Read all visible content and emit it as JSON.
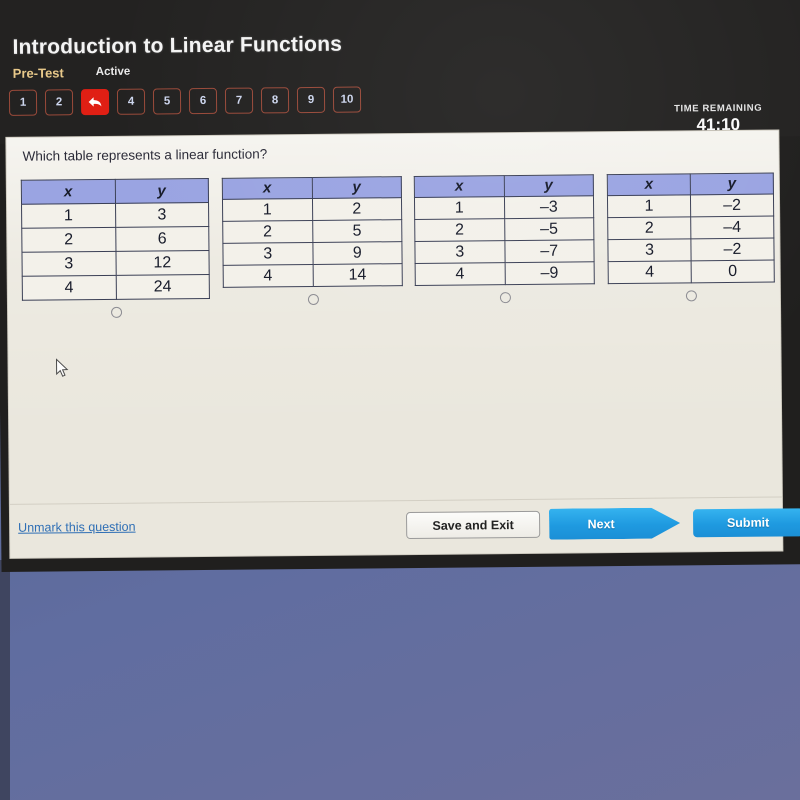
{
  "header": {
    "course_title": "Introduction to Linear Functions",
    "test_type": "Pre-Test",
    "status": "Active",
    "time_label": "TIME REMAINING",
    "time_value": "41:10",
    "question_nav": [
      {
        "label": "1",
        "flagged": false
      },
      {
        "label": "2",
        "flagged": false
      },
      {
        "label": "3",
        "flagged": true,
        "icon": "back-arrow-icon"
      },
      {
        "label": "4",
        "flagged": false
      },
      {
        "label": "5",
        "flagged": false
      },
      {
        "label": "6",
        "flagged": false
      },
      {
        "label": "7",
        "flagged": false
      },
      {
        "label": "8",
        "flagged": false
      },
      {
        "label": "9",
        "flagged": false
      },
      {
        "label": "10",
        "flagged": false
      }
    ]
  },
  "question": {
    "prompt": "Which table represents a linear function?",
    "choices": [
      {
        "headers": [
          "x",
          "y"
        ],
        "rows": [
          [
            "1",
            "3"
          ],
          [
            "2",
            "6"
          ],
          [
            "3",
            "12"
          ],
          [
            "4",
            "24"
          ]
        ],
        "selected": false
      },
      {
        "headers": [
          "x",
          "y"
        ],
        "rows": [
          [
            "1",
            "2"
          ],
          [
            "2",
            "5"
          ],
          [
            "3",
            "9"
          ],
          [
            "4",
            "14"
          ]
        ],
        "selected": false
      },
      {
        "headers": [
          "x",
          "y"
        ],
        "rows": [
          [
            "1",
            "–3"
          ],
          [
            "2",
            "–5"
          ],
          [
            "3",
            "–7"
          ],
          [
            "4",
            "–9"
          ]
        ],
        "selected": false
      },
      {
        "headers": [
          "x",
          "y"
        ],
        "rows": [
          [
            "1",
            "–2"
          ],
          [
            "2",
            "–4"
          ],
          [
            "3",
            "–2"
          ],
          [
            "4",
            "0"
          ]
        ],
        "selected": false
      }
    ]
  },
  "footer": {
    "unmark_link": "Unmark this question",
    "save_exit_label": "Save and Exit",
    "next_label": "Next",
    "submit_label": "Submit"
  },
  "colors": {
    "header_bg": "#232221",
    "panel_bg": "#eae7dd",
    "table_header": "#9aa4e2",
    "table_border": "#3a3f55",
    "flag_red": "#e01f14",
    "accent_blue": "#1f9ae0",
    "link_blue": "#2f6fb5",
    "pretest_gold": "#e8c98a",
    "desktop_blue": "#5d6c9e"
  }
}
